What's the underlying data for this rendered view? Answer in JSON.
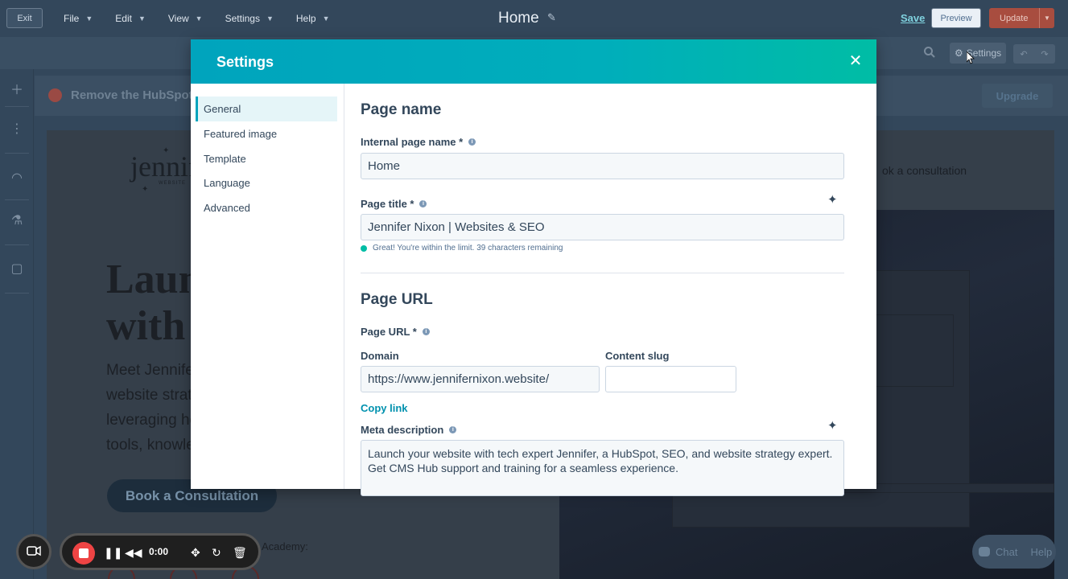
{
  "topbar": {
    "exit": "Exit",
    "menus": [
      {
        "label": "File"
      },
      {
        "label": "Edit"
      },
      {
        "label": "View"
      },
      {
        "label": "Settings"
      },
      {
        "label": "Help"
      }
    ],
    "page_title": "Home",
    "save": "Save",
    "preview": "Preview",
    "update": "Update"
  },
  "toolbar": {
    "settings": "Settings"
  },
  "banner": {
    "text": "Remove the HubSpot lo",
    "upgrade": "Upgrade"
  },
  "background": {
    "logo": "jennife",
    "logo_sub": "WEBSITE",
    "nav_link": "ok a consultation",
    "hero_lines": [
      "Laun",
      "with a"
    ],
    "hero_para": [
      "Meet Jennife",
      "website strat",
      "leveraging he",
      "tools, knowle"
    ],
    "cta": "Book a Consultation",
    "academy": "Academy:"
  },
  "modal": {
    "title": "Settings",
    "nav": [
      {
        "label": "General",
        "active": true
      },
      {
        "label": "Featured image"
      },
      {
        "label": "Template"
      },
      {
        "label": "Language"
      },
      {
        "label": "Advanced"
      }
    ],
    "page_name_section": "Page name",
    "internal_name_label": "Internal page name *",
    "internal_name_value": "Home",
    "page_title_label": "Page title *",
    "page_title_value": "Jennifer Nixon | Websites & SEO",
    "page_title_hint": "Great! You're within the limit. 39 characters remaining",
    "page_url_section": "Page URL",
    "page_url_label": "Page URL *",
    "domain_label": "Domain",
    "domain_value": "https://www.jennifernixon.website/",
    "slug_label": "Content slug",
    "slug_value": "",
    "copy_link": "Copy link",
    "meta_label": "Meta description",
    "meta_value": "Launch your website with tech expert Jennifer, a HubSpot, SEO, and website strategy expert. Get CMS Hub support and training for a seamless experience."
  },
  "recorder": {
    "time": "0:00"
  },
  "chat": {
    "chat": "Chat",
    "help": "Help"
  },
  "colors": {
    "modal_header_start": "#00a4bd",
    "modal_header_end": "#00bda5",
    "link": "#0091ae",
    "update_button": "#a84d3f"
  }
}
